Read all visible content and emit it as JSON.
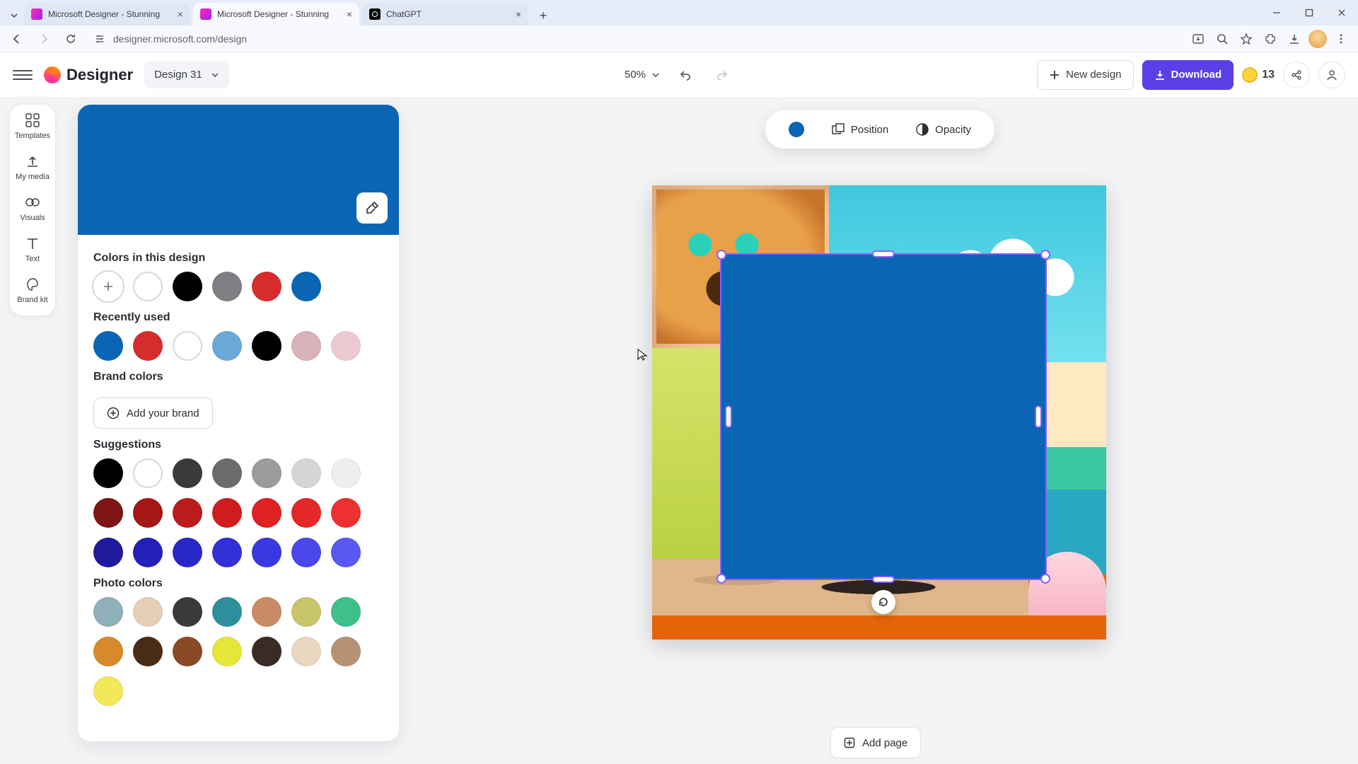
{
  "browser": {
    "tabs": [
      {
        "title": "Microsoft Designer - Stunning",
        "active": false,
        "favicon": "designer"
      },
      {
        "title": "Microsoft Designer - Stunning",
        "active": true,
        "favicon": "designer"
      },
      {
        "title": "ChatGPT",
        "active": false,
        "favicon": "chatgpt"
      }
    ],
    "url_domain": "designer.microsoft.com",
    "url_path": "/design"
  },
  "app": {
    "brand": "Designer",
    "design_name": "Design 31",
    "zoom": "50%",
    "new_design_label": "New design",
    "download_label": "Download",
    "coins": "13"
  },
  "left_rail": {
    "items": [
      "Templates",
      "My media",
      "Visuals",
      "Text",
      "Brand kit"
    ]
  },
  "color_panel": {
    "current_hex": "#0a66b4",
    "sections": {
      "in_design_label": "Colors in this design",
      "recent_label": "Recently used",
      "brand_label": "Brand colors",
      "add_brand_label": "Add your brand",
      "suggestions_label": "Suggestions",
      "photo_label": "Photo colors"
    },
    "colors_in_design": [
      "add",
      "#ffffff",
      "#000000",
      "#7d7f83",
      "#d62c2c",
      "#0a66b4"
    ],
    "recently_used": [
      "#0a66b4",
      "#d62c2c",
      "#ffffff",
      "#6aa8d8",
      "#000000",
      "#d9b1b8",
      "#ecc9d1"
    ],
    "suggestions": [
      "#000000",
      "#ffffff",
      "#3a3a3a",
      "#6b6b6b",
      "#9b9b9b",
      "#d5d5d5",
      "#eeeeee",
      "#7e1515",
      "#a51616",
      "#bb1b1b",
      "#cf1d1d",
      "#de2121",
      "#e42828",
      "#ed3030",
      "#1f1a9c",
      "#2320b8",
      "#2a27c9",
      "#3230d6",
      "#3a38e0",
      "#4a48ea",
      "#5a58f2"
    ],
    "photo_colors": [
      "#8fb0b8",
      "#e6cfb5",
      "#3a3a3a",
      "#2d8f9c",
      "#c98b63",
      "#c8c56a",
      "#3fbf8a",
      "#d68a2a",
      "#4a2b16",
      "#8a4a26",
      "#e6e63a",
      "#3a2c24",
      "#e9d7bf",
      "#b89276",
      "#f2e85a"
    ]
  },
  "ctx_toolbar": {
    "position_label": "Position",
    "opacity_label": "Opacity"
  },
  "add_page_label": "Add page"
}
